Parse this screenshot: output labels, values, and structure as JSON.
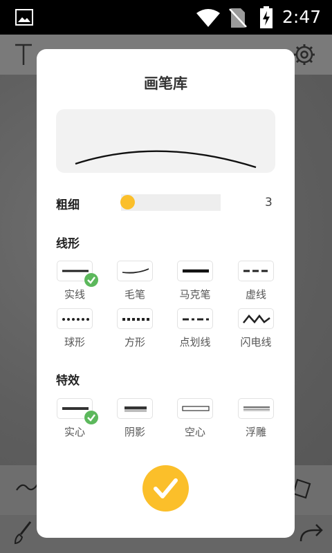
{
  "status_bar": {
    "time": "2:47",
    "icons": [
      "gallery-icon",
      "wifi-icon",
      "no-sim-icon",
      "battery-charging-icon"
    ]
  },
  "dialog": {
    "title": "画笔库",
    "thickness": {
      "label": "粗细",
      "value": "3",
      "fill_fraction": 0.04
    },
    "line_shapes": {
      "label": "线形",
      "items": [
        {
          "label": "实线",
          "selected": true
        },
        {
          "label": "毛笔",
          "selected": false
        },
        {
          "label": "马克笔",
          "selected": false
        },
        {
          "label": "虚线",
          "selected": false
        },
        {
          "label": "球形",
          "selected": false
        },
        {
          "label": "方形",
          "selected": false
        },
        {
          "label": "点划线",
          "selected": false
        },
        {
          "label": "闪电线",
          "selected": false
        }
      ]
    },
    "effects": {
      "label": "特效",
      "items": [
        {
          "label": "实心",
          "selected": true
        },
        {
          "label": "阴影",
          "selected": false
        },
        {
          "label": "空心",
          "selected": false
        },
        {
          "label": "浮雕",
          "selected": false
        }
      ]
    },
    "confirm_icon": "checkmark-icon"
  },
  "colors": {
    "accent": "#fbbf2a",
    "selected_check": "#5cb85c"
  }
}
